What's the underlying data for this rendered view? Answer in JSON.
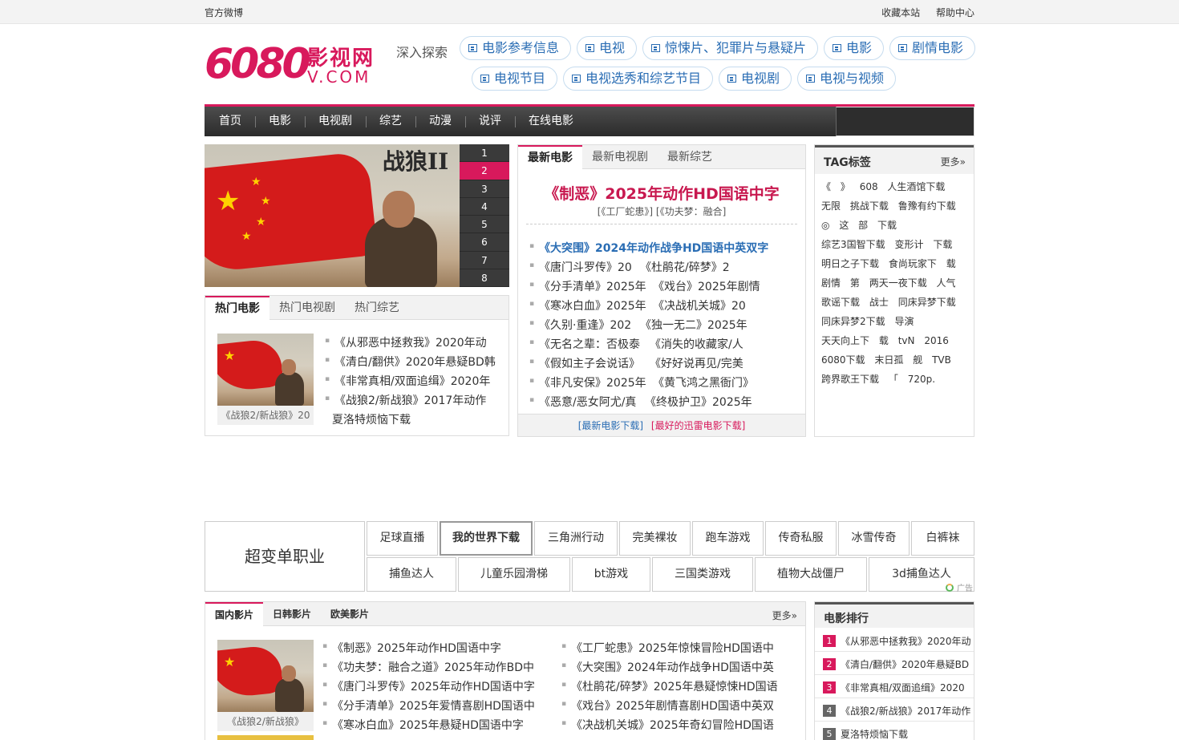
{
  "topbar": {
    "left": "官方微博",
    "bookmark": "收藏本站",
    "help": "帮助中心"
  },
  "logo": {
    "number": "6080",
    "name": "影视网",
    "domain": "V.COM"
  },
  "explore": {
    "label": "深入探索",
    "row1": [
      "电影参考信息",
      "电视",
      "惊悚片、犯罪片与悬疑片",
      "电影",
      "剧情电影"
    ],
    "row2": [
      "电视节目",
      "电视选秀和综艺节目",
      "电视剧",
      "电视与视频"
    ]
  },
  "nav": [
    "首页",
    "电影",
    "电视剧",
    "综艺",
    "动漫",
    "说评",
    "在线电影"
  ],
  "slider": {
    "poster_title": "战狼II",
    "numbers": [
      "1",
      "2",
      "3",
      "4",
      "5",
      "6",
      "7",
      "8"
    ],
    "active": "2"
  },
  "hot": {
    "tabs": [
      "热门电影",
      "热门电视剧",
      "热门综艺"
    ],
    "thumb_caption": "《战狼2/新战狼》20",
    "items": [
      "《从邪恶中拯救我》2020年动",
      "《清白/翻供》2020年悬疑BD韩",
      "《非常真相/双面追缉》2020年",
      "《战狼2/新战狼》2017年动作",
      "夏洛特烦恼下载"
    ]
  },
  "latest": {
    "tabs": [
      "最新电影",
      "最新电视剧",
      "最新综艺"
    ],
    "headline": "《制恶》2025年动作HD国语中字",
    "sub": "[《工厂蛇患》] [《功夫梦：融合]",
    "items": [
      [
        "《大突围》2024年动作战争HD国语中英双字",
        ""
      ],
      [
        "《唐门斗罗传》20",
        "《杜鹃花/碎梦》2"
      ],
      [
        "《分手清单》2025年",
        "《戏台》2025年剧情"
      ],
      [
        "《寒冰白血》2025年",
        "《决战机关城》20"
      ],
      [
        "《久别·重逢》202",
        "《独一无二》2025年"
      ],
      [
        "《无名之辈：否极泰",
        "《消失的收藏家/人"
      ],
      [
        "《假如主子会说话》",
        "《好好说再见/完美"
      ],
      [
        "《非凡安保》2025年",
        "《黄飞鸿之黑衙门》"
      ],
      [
        "《恶意/恶女阿尤/真",
        "《终极护卫》2025年"
      ]
    ],
    "foot_a": "[最新电影下载]",
    "foot_b": "[最好的迅雷电影下载]"
  },
  "tags": {
    "title": "TAG标签",
    "more": "更多»",
    "cloud": [
      "《",
      "》",
      "608",
      "人生酒馆下载",
      "无限",
      "挑战下载",
      "鲁豫有约下载",
      "◎",
      "这",
      "部",
      "下载",
      "综艺3国智下载",
      "变形计",
      "下载",
      "明日之子下载",
      "食尚玩家下",
      "载",
      "剧情",
      "第",
      "两天一夜下载",
      "人气",
      "歌谣下载",
      "战士",
      "同床异梦下载",
      "同床异梦2下载",
      "导演",
      "天天向上下",
      "载",
      "tvN",
      "2016",
      "6080下载",
      "末日孤",
      "舰",
      "TVB",
      "跨界歌王下载",
      "「",
      "720p."
    ]
  },
  "ads": {
    "big": "超变单职业",
    "row1": [
      "足球直播",
      "我的世界下载",
      "三角洲行动",
      "完美裸妆",
      "跑车游戏",
      "传奇私服",
      "冰雪传奇",
      "白裤袜"
    ],
    "row2": [
      "捕鱼达人",
      "儿童乐园滑梯",
      "bt游戏",
      "三国类游戏",
      "植物大战僵尸",
      "3d捕鱼达人"
    ],
    "ad_label": "广告"
  },
  "region": {
    "tabs": [
      "国内影片",
      "日韩影片",
      "欧美影片"
    ],
    "more": "更多»",
    "thumb_caption": "《战狼2/新战狼》",
    "col1": [
      "《制恶》2025年动作HD国语中字",
      "《功夫梦：融合之道》2025年动作BD中",
      "《唐门斗罗传》2025年动作HD国语中字",
      "《分手清单》2025年爱情喜剧HD国语中",
      "《寒冰白血》2025年悬疑HD国语中字"
    ],
    "col2": [
      "《工厂蛇患》2025年惊悚冒险HD国语中",
      "《大突围》2024年动作战争HD国语中英",
      "《杜鹃花/碎梦》2025年悬疑惊悚HD国语",
      "《戏台》2025年剧情喜剧HD国语中英双",
      "《决战机关城》2025年奇幻冒险HD国语"
    ]
  },
  "rank": {
    "title": "电影排行",
    "items": [
      "《从邪恶中拯救我》2020年动",
      "《清白/翻供》2020年悬疑BD",
      "《非常真相/双面追缉》2020",
      "《战狼2/新战狼》2017年动作",
      "夏洛特烦恼下载"
    ],
    "numbers": [
      "1",
      "2",
      "3",
      "4",
      "5"
    ]
  },
  "colors": {
    "accent": "#d8195c",
    "link": "#2a6db4",
    "nav": "#333333"
  }
}
